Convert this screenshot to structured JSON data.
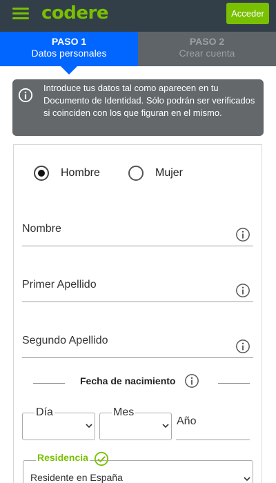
{
  "header": {
    "menu_icon": "hamburger-icon",
    "logo_text": "codere",
    "login_label": "Acceder",
    "brand_color": "#79c000",
    "bar_color": "#333f48"
  },
  "steps": [
    {
      "number": "PASO 1",
      "label": "Datos personales",
      "active": true,
      "color": "#0066ff"
    },
    {
      "number": "PASO 2",
      "label": "Crear cuenta",
      "active": false
    }
  ],
  "info_banner": {
    "icon": "info-icon",
    "text": "Introduce tus datos tal como aparecen en tu Documento de Identidad. Sólo podrán ser verificados si coinciden con los que figuran en el mismo."
  },
  "form": {
    "gender": {
      "options": [
        "Hombre",
        "Mujer"
      ],
      "selected": "Hombre"
    },
    "fields": [
      {
        "label": "Nombre",
        "icon": "info-icon"
      },
      {
        "label": "Primer Apellido",
        "icon": "info-icon"
      },
      {
        "label": "Segundo Apellido",
        "icon": "info-icon"
      }
    ],
    "birthdate": {
      "title": "Fecha de nacimiento",
      "icon": "info-icon",
      "day_label": "Día",
      "month_label": "Mes",
      "year_label": "Año"
    },
    "residence": {
      "label": "Residencia",
      "status_icon": "check-circle-icon",
      "value": "Residente en España"
    }
  }
}
